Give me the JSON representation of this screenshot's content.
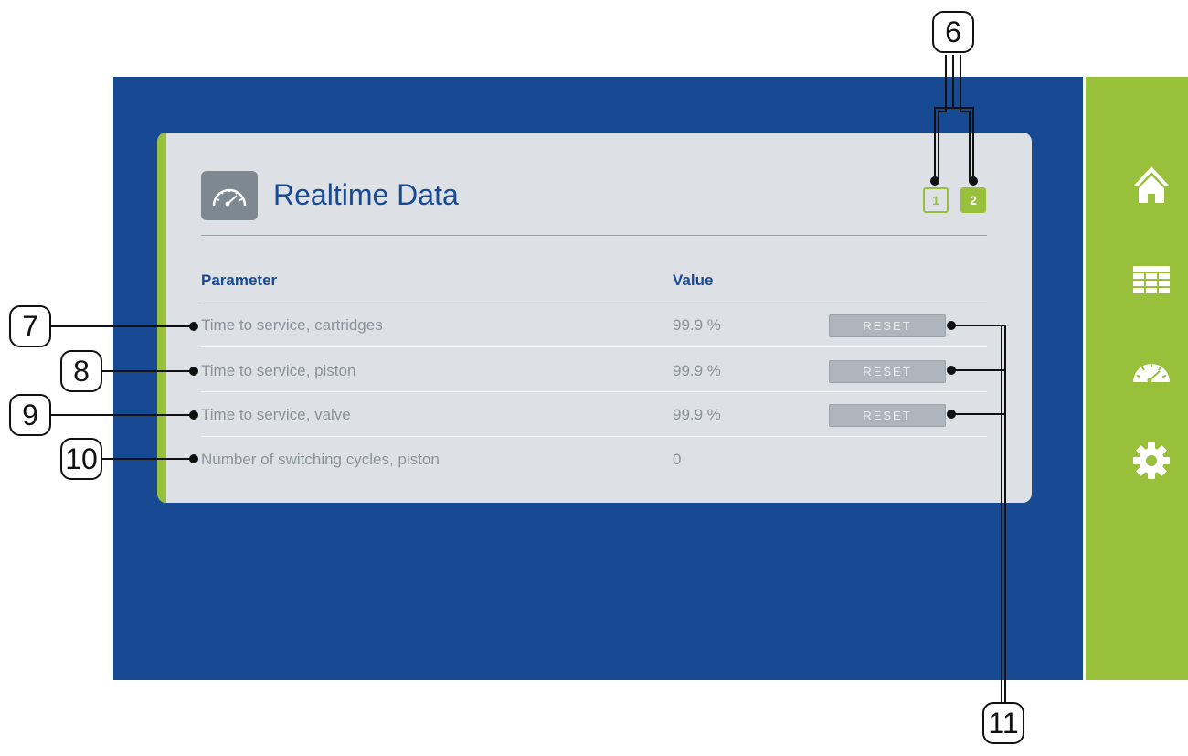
{
  "app": {
    "title": "Realtime Data",
    "title_icon": "speedometer-icon",
    "pager": [
      "1",
      "2"
    ],
    "active_page": "2"
  },
  "table": {
    "headers": {
      "parameter": "Parameter",
      "value": "Value"
    },
    "rows": [
      {
        "parameter": "Time to service, cartridges",
        "value": "99.9 %",
        "action": "RESET"
      },
      {
        "parameter": "Time to service, piston",
        "value": "99.9 %",
        "action": "RESET"
      },
      {
        "parameter": "Time to service, valve",
        "value": "99.9 %",
        "action": "RESET"
      },
      {
        "parameter": "Number of switching cycles, piston",
        "value": "0"
      }
    ]
  },
  "sidebar": {
    "items": [
      {
        "icon": "home-icon"
      },
      {
        "icon": "table-icon"
      },
      {
        "icon": "speedometer-icon"
      },
      {
        "icon": "gear-icon"
      }
    ]
  },
  "callouts": [
    "6",
    "7",
    "8",
    "9",
    "10",
    "11"
  ],
  "colors": {
    "screen_background": "#174a93",
    "accent_green": "#98c03a",
    "card_background": "#dde1e6",
    "text_blue": "#174a93",
    "text_gray": "#8a929a"
  }
}
